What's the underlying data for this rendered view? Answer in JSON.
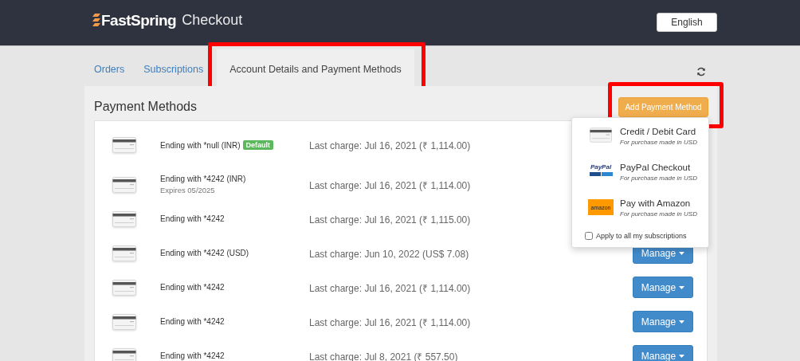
{
  "header": {
    "brand": "FastSpring",
    "product": "Checkout",
    "language": "English"
  },
  "tabs": [
    {
      "label": "Orders",
      "selected": false,
      "highlighted": false
    },
    {
      "label": "Subscriptions",
      "selected": false,
      "highlighted": false
    },
    {
      "label": "Account Details and Payment Methods",
      "selected": true,
      "highlighted": true
    }
  ],
  "panel": {
    "title": "Payment Methods",
    "add_button": {
      "label": "Add Payment Method",
      "highlighted": true
    }
  },
  "methods": [
    {
      "label": "Ending with *null (INR)",
      "badge": "Default",
      "last_charge": "Last charge: Jul 16, 2021 (₹ 1,114.00)"
    },
    {
      "label": "Ending with *4242 (INR)",
      "expires": "Expires 05/2025",
      "last_charge": "Last charge: Jul 16, 2021 (₹ 1,114.00)"
    },
    {
      "label": "Ending with *4242",
      "last_charge": "Last charge: Jul 16, 2021 (₹ 1,115.00)"
    },
    {
      "label": "Ending with *4242 (USD)",
      "last_charge": "Last charge: Jun 10, 2022 (US$ 7.08)",
      "manage": "Manage"
    },
    {
      "label": "Ending with *4242",
      "last_charge": "Last charge: Jul 16, 2021 (₹ 1,114.00)",
      "manage": "Manage"
    },
    {
      "label": "Ending with *4242",
      "last_charge": "Last charge: Jul 16, 2021 (₹ 1,114.00)",
      "manage": "Manage"
    },
    {
      "label": "Ending with *4242",
      "last_charge": "Last charge: Jul 8, 2021 (₹ 557.50)",
      "manage": "Manage"
    }
  ],
  "add_menu": {
    "options": [
      {
        "kind": "card",
        "title": "Credit / Debit Card",
        "note": "For purchase made in USD"
      },
      {
        "kind": "paypal",
        "logo_text": "PayPal",
        "title": "PayPal Checkout",
        "note": "For purchase made in USD"
      },
      {
        "kind": "amazon",
        "logo_text": "amazon",
        "title": "Pay with Amazon",
        "note": "For purchase made in USD"
      }
    ],
    "apply_all": {
      "label": "Apply to all my subscriptions",
      "checked": false
    }
  }
}
